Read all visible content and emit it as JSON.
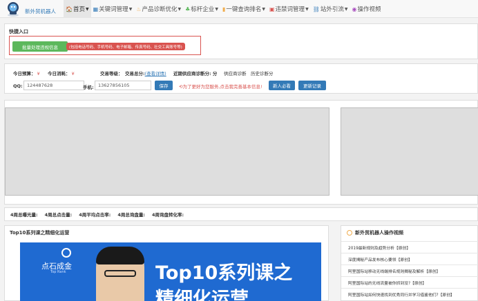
{
  "brand": "新外贸机器人",
  "nav": [
    {
      "label": "首页",
      "icon": "home-icon",
      "glyph": "🏠",
      "color": "#d9534f",
      "caret": true
    },
    {
      "label": "关键词管理",
      "icon": "list-icon",
      "glyph": "▦",
      "color": "#337ab7",
      "caret": true
    },
    {
      "label": "产品诊断优化",
      "icon": "fire-icon",
      "glyph": "♨",
      "color": "#f0ad4e",
      "caret": true
    },
    {
      "label": "标杆企业",
      "icon": "tree-icon",
      "glyph": "♣",
      "color": "#5cb85c",
      "caret": true
    },
    {
      "label": "一键查询排名",
      "icon": "bar-chart-icon",
      "glyph": "▮",
      "color": "#f0ad4e",
      "caret": true
    },
    {
      "label": "违禁词管理",
      "icon": "briefcase-icon",
      "glyph": "▣",
      "color": "#d9534f",
      "caret": true
    },
    {
      "label": "站外引流",
      "icon": "link-icon",
      "glyph": "⛓",
      "color": "#337ab7",
      "caret": true
    },
    {
      "label": "操作视频",
      "icon": "play-icon",
      "glyph": "◉",
      "color": "#a94fbf",
      "caret": false
    }
  ],
  "quick": {
    "title": "快捷入口",
    "batch_button": "批量处理违规信息",
    "note": "(包括电话号码、手机号码、电子邮箱、传真号码、社交工具账号等)"
  },
  "stats": {
    "today_budget": "今日预算：",
    "today_budget_val": "¥",
    "today_spend": "今日消耗：",
    "today_spend_val": "¥",
    "trade_level": "交易等级：",
    "trade_total": "交易总分:",
    "view_detail": "(查看详情)",
    "supplier_score": "近期供应商诊断分: 分",
    "supplier_diag": "供应商诊断",
    "history_diag": "历史诊断分"
  },
  "contact": {
    "qq_label": "QQ:",
    "qq_value": "124487628",
    "phone_label": "手机:",
    "phone_value": "13627856105",
    "save": "保存",
    "warn": "为了更好为您服务,点击我完善基本信息!",
    "newbie": "新人必看",
    "changelog": "更新记录"
  },
  "weekly": [
    "4周总曝光量:",
    "4周总点击量:",
    "4周平均点击率:",
    "4周总询盘量:",
    "4周询盘转化率:"
  ],
  "course": {
    "title": "Top10系列课之精细化运营",
    "banner_brand": "点石成金",
    "banner_brand_en": "Top Rank",
    "banner_line1": "Top10系列课之",
    "banner_line2": "精细化运营"
  },
  "videos": {
    "title": "新外贸机器人操作视频",
    "items": [
      "2019最新规则及趋势分析【原创】",
      "深度揭秘产品发布核心要领【原创】",
      "阿里国际站移动无线端排名规则揭秘及解析【原创】",
      "阿里国际站的无线流量被你抓到没?【原创】",
      "阿里国际站如何快速找到优秀同行并学习借鉴他们?【原创】"
    ]
  }
}
